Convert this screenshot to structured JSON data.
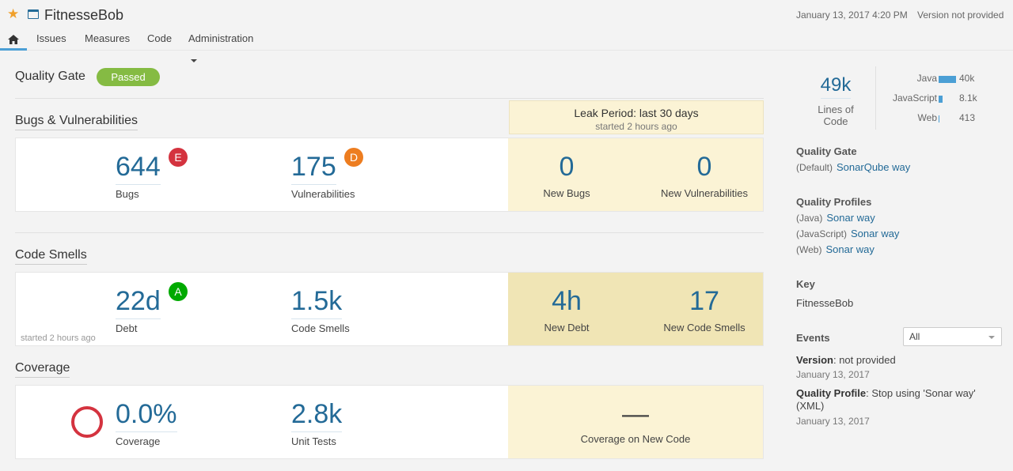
{
  "header": {
    "project_name": "FitnesseBob",
    "date": "January 13, 2017 4:20 PM",
    "version": "Version not provided"
  },
  "nav": {
    "home_icon": "home-icon",
    "issues": "Issues",
    "measures": "Measures",
    "code": "Code",
    "administration": "Administration"
  },
  "quality_gate": {
    "title": "Quality Gate",
    "status": "Passed"
  },
  "leak_period": {
    "title": "Leak Period: last 30 days",
    "started": "started 2 hours ago"
  },
  "bugs_section": {
    "title": "Bugs & Vulnerabilities",
    "bugs": {
      "value": "644",
      "label": "Bugs",
      "rating": "E"
    },
    "vulnerabilities": {
      "value": "175",
      "label": "Vulnerabilities",
      "rating": "D"
    },
    "new_bugs": {
      "value": "0",
      "label": "New Bugs"
    },
    "new_vulnerabilities": {
      "value": "0",
      "label": "New Vulnerabilities"
    }
  },
  "smells_section": {
    "title": "Code Smells",
    "debt": {
      "value": "22d",
      "label": "Debt",
      "rating": "A"
    },
    "code_smells": {
      "value": "1.5k",
      "label": "Code Smells"
    },
    "started_note": "started 2 hours ago",
    "new_debt": {
      "value": "4h",
      "label": "New Debt"
    },
    "new_code_smells": {
      "value": "17",
      "label": "New Code Smells"
    }
  },
  "coverage_section": {
    "title": "Coverage",
    "coverage": {
      "value": "0.0%",
      "label": "Coverage"
    },
    "unit_tests": {
      "value": "2.8k",
      "label": "Unit Tests"
    },
    "new_coverage": {
      "value": "—",
      "label": "Coverage on New Code"
    }
  },
  "sidebar": {
    "lines_of_code": {
      "value": "49k",
      "label": "Lines of Code"
    },
    "languages": [
      {
        "name": "Java",
        "value": "40k",
        "share": 0.82
      },
      {
        "name": "JavaScript",
        "value": "8.1k",
        "share": 0.17
      },
      {
        "name": "Web",
        "value": "413",
        "share": 0.01
      }
    ],
    "quality_gate": {
      "heading": "Quality Gate",
      "prefix": "(Default)",
      "link": "SonarQube way"
    },
    "quality_profiles": {
      "heading": "Quality Profiles",
      "items": [
        {
          "lang": "(Java)",
          "link": "Sonar way"
        },
        {
          "lang": "(JavaScript)",
          "link": "Sonar way"
        },
        {
          "lang": "(Web)",
          "link": "Sonar way"
        }
      ]
    },
    "key": {
      "heading": "Key",
      "value": "FitnesseBob"
    },
    "events": {
      "heading": "Events",
      "filter": "All",
      "items": [
        {
          "label": "Version",
          "text": ": not provided",
          "date": "January 13, 2017"
        },
        {
          "label": "Quality Profile",
          "text": ": Stop using 'Sonar way' (XML)",
          "date": "January 13, 2017"
        }
      ]
    }
  },
  "colors": {
    "accent": "#236a97",
    "passed": "#85bb43",
    "rating_e": "#d4333f",
    "rating_d": "#ed7d20",
    "rating_a": "#00aa00",
    "leak_bg": "#fbf3d5"
  }
}
